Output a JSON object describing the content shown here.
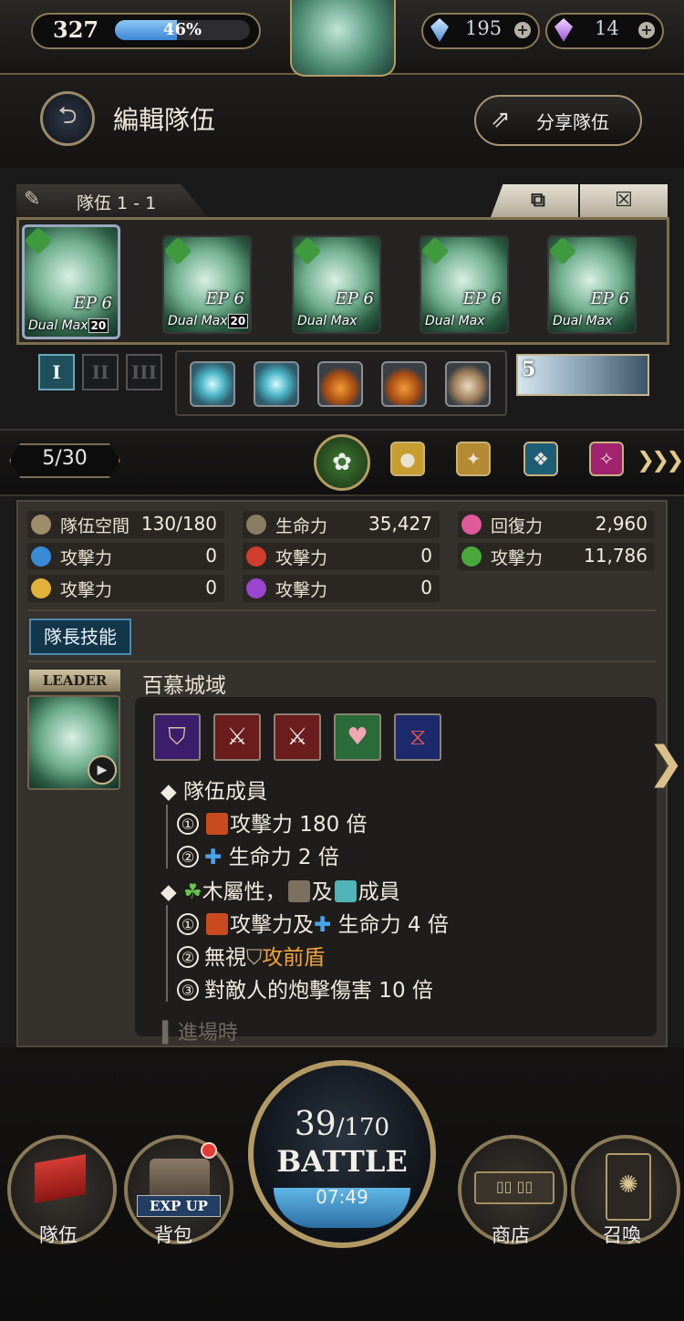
{
  "top_bar": {
    "level": "327",
    "xp_progress": 0.46,
    "xp_percent_label": "46%",
    "gem_blue_count": "195",
    "gem_purple_count": "14"
  },
  "header": {
    "title": "編輯隊伍",
    "share_label": "分享隊伍"
  },
  "team": {
    "name": "隊伍 1 - 1",
    "copy_icon": "copy-icon",
    "close_icon": "close-icon",
    "cards": [
      {
        "ep": "EP 6",
        "dual": "Dual Max",
        "lv": "20"
      },
      {
        "ep": "EP 6",
        "dual": "Dual Max",
        "lv": "20"
      },
      {
        "ep": "EP 6",
        "dual": "Dual Max",
        "lv": ""
      },
      {
        "ep": "EP 6",
        "dual": "Dual Max",
        "lv": ""
      },
      {
        "ep": "EP 6",
        "dual": "Dual Max",
        "lv": ""
      }
    ],
    "formation": [
      "I",
      "II",
      "III"
    ],
    "guardian_number": "5"
  },
  "filters": {
    "count": "5/30"
  },
  "stats": [
    {
      "label": "隊伍空間",
      "value": "130/180",
      "icon": "flag-icon",
      "color": "#9d8d6a"
    },
    {
      "label": "生命力",
      "value": "35,427",
      "icon": "drop-icon",
      "color": "#8a7d62"
    },
    {
      "label": "回復力",
      "value": "2,960",
      "icon": "heart-icon",
      "color": "#e05a9a"
    },
    {
      "label": "攻擊力",
      "value": "0",
      "icon": "water-icon",
      "color": "#3a8bd6"
    },
    {
      "label": "攻擊力",
      "value": "0",
      "icon": "fire-icon",
      "color": "#d23c2c"
    },
    {
      "label": "攻擊力",
      "value": "11,786",
      "icon": "wood-icon",
      "color": "#49a93d"
    },
    {
      "label": "攻擊力",
      "value": "0",
      "icon": "light-icon",
      "color": "#e2b23a"
    },
    {
      "label": "攻擊力",
      "value": "0",
      "icon": "dark-icon",
      "color": "#9a45cf"
    }
  ],
  "leader_skill": {
    "tab_label": "隊長技能",
    "badge": "LEADER",
    "name": "百慕城域",
    "lines": {
      "h1": "隊伍成員",
      "l1_num": "①",
      "l1_text": "攻擊力 180 倍",
      "l2_num": "②",
      "l2_text": "生命力 2 倍",
      "h2_a": "木屬性，",
      "h2_b": "及",
      "h2_c": "成員",
      "l3_num": "①",
      "l3_a": "攻擊力及",
      "l3_b": "生命力 4 倍",
      "l4_num": "②",
      "l4_a": "無視",
      "l4_b": "攻前盾",
      "l5_num": "③",
      "l5_text": "對敵人的炮擊傷害 10 倍",
      "faded": "進場時"
    }
  },
  "bottom_nav": {
    "team_label": "隊伍",
    "bag_label": "背包",
    "exp_up": "EXP UP",
    "battle_current": "39",
    "battle_total": "/170",
    "battle_word": "BATTLE",
    "battle_timer": "07:49",
    "shop_label": "商店",
    "summon_label": "召喚"
  }
}
